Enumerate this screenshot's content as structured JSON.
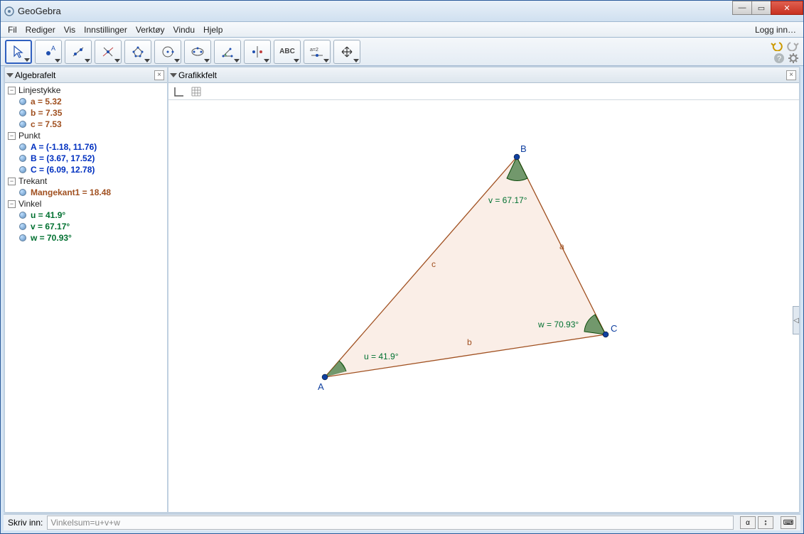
{
  "window": {
    "title": "GeoGebra"
  },
  "menu": {
    "fil": "Fil",
    "rediger": "Rediger",
    "vis": "Vis",
    "innstillinger": "Innstillinger",
    "verktoy": "Verktøy",
    "vindu": "Vindu",
    "hjelp": "Hjelp",
    "login": "Logg inn…"
  },
  "panels": {
    "algebra": "Algebrafelt",
    "graphics": "Grafikkfelt"
  },
  "algebra": {
    "groups": {
      "linjestykke": {
        "label": "Linjestykke",
        "items": [
          {
            "text": "a = 5.32"
          },
          {
            "text": "b = 7.35"
          },
          {
            "text": "c = 7.53"
          }
        ]
      },
      "punkt": {
        "label": "Punkt",
        "items": [
          {
            "text": "A = (-1.18, 11.76)"
          },
          {
            "text": "B = (3.67, 17.52)"
          },
          {
            "text": "C = (6.09, 12.78)"
          }
        ]
      },
      "trekant": {
        "label": "Trekant",
        "items": [
          {
            "text": "Mangekant1 = 18.48"
          }
        ]
      },
      "vinkel": {
        "label": "Vinkel",
        "items": [
          {
            "text": "u = 41.9°"
          },
          {
            "text": "v = 67.17°"
          },
          {
            "text": "w = 70.93°"
          }
        ]
      }
    }
  },
  "graphics": {
    "points": {
      "A": "A",
      "B": "B",
      "C": "C"
    },
    "sides": {
      "a": "a",
      "b": "b",
      "c": "c"
    },
    "angles": {
      "u": "u = 41.9°",
      "v": "v = 67.17°",
      "w": "w = 70.93°"
    }
  },
  "footer": {
    "label": "Skriv inn:",
    "value": "Vinkelsum=u+v+w",
    "alpha": "α"
  },
  "chart_data": {
    "type": "table",
    "title": "Triangle ABC",
    "points": [
      {
        "name": "A",
        "x": -1.18,
        "y": 11.76
      },
      {
        "name": "B",
        "x": 3.67,
        "y": 17.52
      },
      {
        "name": "C",
        "x": 6.09,
        "y": 12.78
      }
    ],
    "segments": [
      {
        "name": "a",
        "length": 5.32
      },
      {
        "name": "b",
        "length": 7.35
      },
      {
        "name": "c",
        "length": 7.53
      }
    ],
    "angles": [
      {
        "name": "u",
        "degrees": 41.9
      },
      {
        "name": "v",
        "degrees": 67.17
      },
      {
        "name": "w",
        "degrees": 70.93
      }
    ],
    "polygon_area": 18.48
  }
}
